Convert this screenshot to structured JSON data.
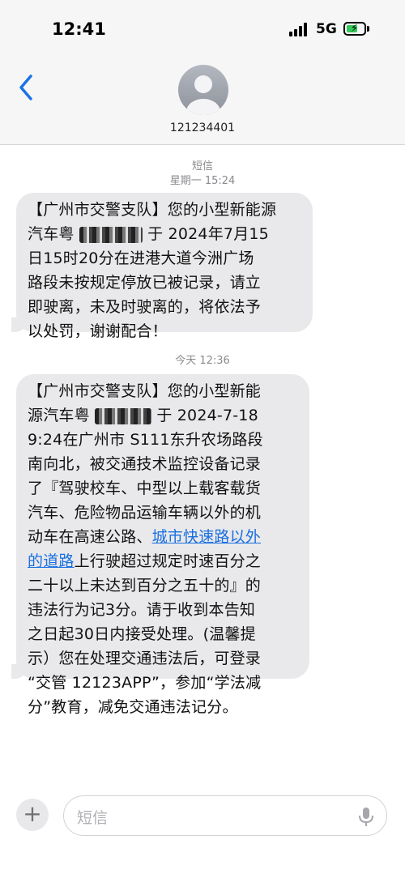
{
  "status": {
    "time": "12:41",
    "network": "5G"
  },
  "header": {
    "contact": "121234401"
  },
  "messages": [
    {
      "section_label": "短信",
      "timestamp": "星期一 15:24",
      "lines": [
        "【广州市交警支队】您的小型新能源",
        "汽车粤",
        "于 2024年7月15",
        "日15时20分在进港大道今洲广场",
        "路段未按规定停放已被记录，请立",
        "即驶离，未及时驶离的，将依法予",
        "以处罚，谢谢配合！"
      ]
    },
    {
      "timestamp": "今天 12:36",
      "lines": [
        "【广州市交警支队】您的小型新能",
        "源汽车粤",
        "于 2024-7-18",
        "9:24在广州市 S111东升农场路段",
        "南向北，被交通技术监控设备记录",
        "了『驾驶校车、中型以上载客载货",
        "汽车、危险物品运输车辆以外的机",
        "动车在高速公路、",
        "城市快速路以外",
        "的道路",
        "上行驶超过规定时速百分之",
        "二十以上未达到百分之五十的』的",
        "违法行为记3分。请于收到本告知",
        "之日起30日内接受处理。(温馨提",
        "示）您在处理交通违法后，可登录",
        "“交管 12123APP”，参加“学法减",
        "分”教育，减免交通违法记分。"
      ]
    }
  ],
  "composer": {
    "placeholder": "短信"
  },
  "icons": [
    "back-chevron-icon",
    "contact-avatar-icon",
    "signal-icon",
    "battery-icon",
    "plus-icon",
    "microphone-icon"
  ],
  "colors": {
    "bubble": "#e9e9eb",
    "link": "#1a6fe0",
    "back": "#1a73e8",
    "battery": "#34c759"
  }
}
